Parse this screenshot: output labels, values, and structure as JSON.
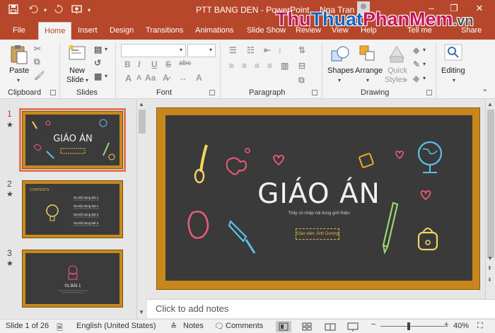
{
  "window": {
    "title": "PTT BANG DEN  -  PowerPoint",
    "user": "Nga Tran",
    "colors": {
      "brand": "#b7472a",
      "ribbon_bg": "#f3f3f3",
      "slide_frame": "#c7871c",
      "chalkboard": "#3a3a3a"
    }
  },
  "quick_access": {
    "save": "save-icon",
    "undo": "undo-icon",
    "redo": "redo-icon",
    "present": "present-from-beginning-icon"
  },
  "window_controls": {
    "minimize": "–",
    "restore": "❐",
    "close": "✕"
  },
  "watermark": {
    "part1": "Thu",
    "part2": "Thuat",
    "part3": "PhanMem",
    "part4": ".vn"
  },
  "tabs": {
    "file": "File",
    "home": "Home",
    "insert": "Insert",
    "design": "Design",
    "transitions": "Transitions",
    "animations": "Animations",
    "slideshow": "Slide Show",
    "review": "Review",
    "view": "View",
    "help": "Help",
    "tellme": "Tell me",
    "share": "Share"
  },
  "ribbon": {
    "clipboard": {
      "label": "Clipboard",
      "paste": "Paste"
    },
    "slides": {
      "label": "Slides",
      "new_slide_line1": "New",
      "new_slide_line2": "Slide"
    },
    "font": {
      "label": "Font",
      "bold": "B",
      "italic": "I",
      "underline": "U",
      "strike": "S",
      "abc": "abc",
      "grow": "A",
      "shrink": "A",
      "aa": "Aa"
    },
    "paragraph": {
      "label": "Paragraph"
    },
    "drawing": {
      "label": "Drawing",
      "shapes": "Shapes",
      "arrange": "Arrange",
      "quick_styles_line1": "Quick",
      "quick_styles_line2": "Styles"
    },
    "editing": {
      "label": "Editing"
    }
  },
  "thumbnails": [
    {
      "number": "1",
      "star": "★"
    },
    {
      "number": "2",
      "star": "★",
      "heading": "CONTENTS",
      "items": [
        "01.Nội dung bài 1",
        "02.Nội dung bài 2",
        "03.Nội dung bài 3",
        "04.Nội dung bài 4"
      ]
    },
    {
      "number": "3",
      "star": "★",
      "caption": "01.BÀI 1"
    }
  ],
  "thumb1": {
    "title": "GIÁO ÁN"
  },
  "slide": {
    "title": "GIÁO ÁN",
    "subtitle": "Thầy cô nhập nội dung giới thiệu",
    "teacher": "Giáo viên: Ánh Dương"
  },
  "notes": {
    "placeholder": "Click to add notes"
  },
  "status": {
    "slide": "Slide 1 of 26",
    "language": "English (United States)",
    "notes": "Notes",
    "comments": "Comments",
    "zoom": "40%"
  }
}
